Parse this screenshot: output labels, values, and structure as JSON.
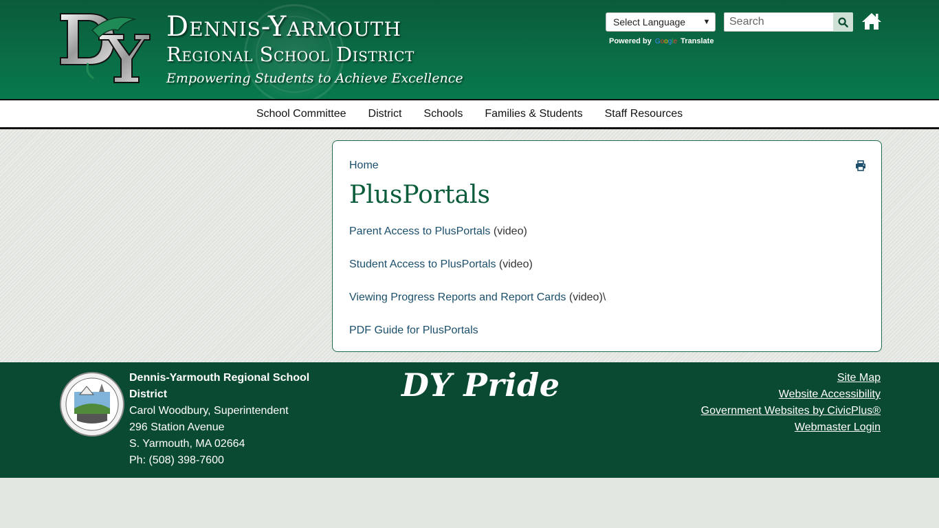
{
  "header": {
    "title_line1": "Dennis-Yarmouth",
    "title_line2": "Regional School District",
    "tagline": "Empowering Students to Achieve Excellence",
    "logo_icon": "dy-logo-icon",
    "colors": {
      "header_green": "#0b6a44",
      "footer_green": "#0b4a32",
      "title_green": "#0b5c3a",
      "link_blue": "#1b4f6b"
    }
  },
  "translate": {
    "select_value": "Select Language",
    "powered_by": "Powered by",
    "google_label": "Google",
    "translate_label": "Translate"
  },
  "search": {
    "placeholder": "Search",
    "icon": "search-icon"
  },
  "home": {
    "icon": "home-icon"
  },
  "nav": {
    "items": [
      {
        "label": "School Committee"
      },
      {
        "label": "District"
      },
      {
        "label": "Schools"
      },
      {
        "label": "Families & Students"
      },
      {
        "label": "Staff Resources"
      }
    ]
  },
  "main": {
    "breadcrumb": "Home",
    "print_icon": "print-icon",
    "title": "PlusPortals",
    "links": [
      {
        "link_text": "Parent Access to PlusPortals",
        "suffix": " (video)"
      },
      {
        "link_text": "Student Access to PlusPortals",
        "suffix": " (video)"
      },
      {
        "link_text": "Viewing Progress Reports and Report Cards",
        "suffix": " (video)\\"
      },
      {
        "link_text": "PDF Guide for PlusPortals",
        "suffix": ""
      }
    ]
  },
  "footer": {
    "org_name": "Dennis-Yarmouth Regional School District",
    "superintendent": "Carol Woodbury, Superintendent",
    "address1": "296 Station Avenue",
    "address2": "S. Yarmouth, MA 02664",
    "phone": "Ph: (508) 398-7600",
    "slogan": "DY Pride",
    "links": [
      {
        "label": "Site Map"
      },
      {
        "label": "Website Accessibility"
      },
      {
        "label": "Government Websites by CivicPlus®"
      },
      {
        "label": "Webmaster Login"
      }
    ]
  }
}
